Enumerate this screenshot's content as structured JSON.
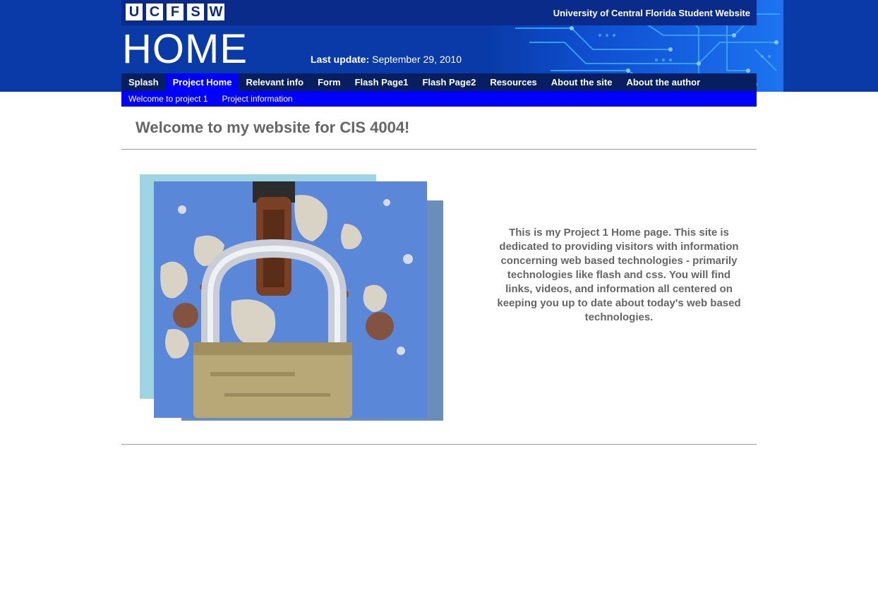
{
  "header": {
    "logo_letters": [
      "U",
      "C",
      "F",
      "S",
      "W"
    ],
    "site_name": "University of Central Florida Student Website",
    "page_heading": "HOME",
    "last_update_label": "Last update:",
    "last_update_value": "September 29, 2010"
  },
  "nav": {
    "items": [
      {
        "label": "Splash"
      },
      {
        "label": "Project Home"
      },
      {
        "label": "Relevant info"
      },
      {
        "label": "Form"
      },
      {
        "label": "Flash Page1"
      },
      {
        "label": "Flash Page2"
      },
      {
        "label": "Resources"
      },
      {
        "label": "About the site"
      },
      {
        "label": "About the author"
      }
    ],
    "active": "Project Home"
  },
  "subnav": {
    "items": [
      {
        "label": "Welcome to project 1"
      },
      {
        "label": "Project information"
      }
    ]
  },
  "main": {
    "welcome_heading": "Welcome to my website for CIS 4004!",
    "intro_text": "This is my Project 1 Home page. This site is dedicated to providing visitors with information concerning web based technologies - primarily technologies like flash and css. You will find links, videos, and information all centered on keeping you up to date about today's web based technologies.",
    "image_subject": "rusty-padlock-photo"
  },
  "colors": {
    "header_blue": "#0a3aa8",
    "nav_dark": "#071e60",
    "nav_active": "#0000ff",
    "text_gray": "#666666"
  }
}
